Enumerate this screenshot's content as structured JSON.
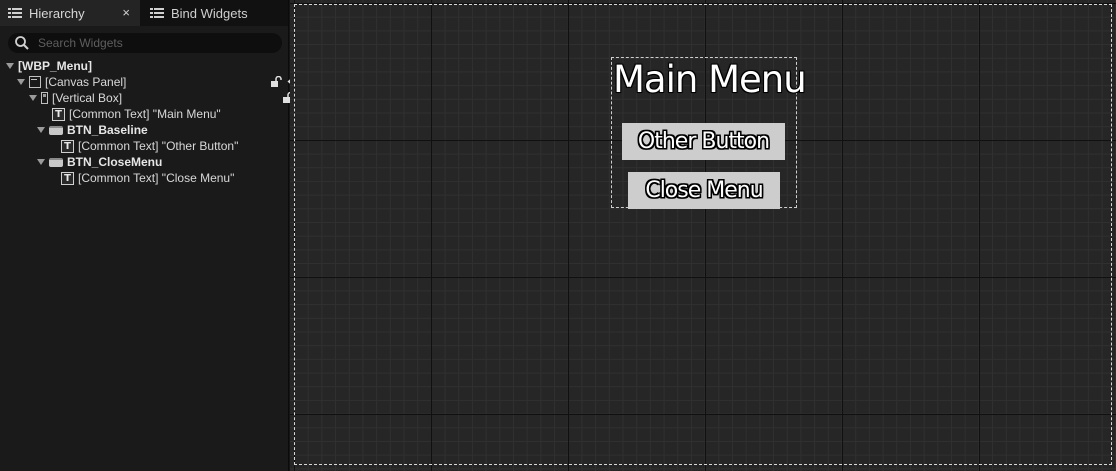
{
  "tabs": {
    "hierarchy": "Hierarchy",
    "close_glyph": "×",
    "bind_widgets": "Bind Widgets"
  },
  "search": {
    "placeholder": "Search Widgets",
    "value": ""
  },
  "tree": [
    {
      "label": "[WBP_Menu]",
      "icon": "none",
      "expanded": true
    },
    {
      "label": "[Canvas Panel]",
      "icon": "canvas-panel-icon",
      "expanded": true
    },
    {
      "label": "[Vertical Box]",
      "icon": "vertical-box-icon",
      "expanded": true
    },
    {
      "label": "[Common Text] \"Main Menu\"",
      "icon": "text-icon"
    },
    {
      "label": "BTN_Baseline",
      "icon": "button-icon",
      "expanded": true
    },
    {
      "label": "[Common Text] \"Other Button\"",
      "icon": "text-icon"
    },
    {
      "label": "BTN_CloseMenu",
      "icon": "button-icon",
      "expanded": true
    },
    {
      "label": "[Common Text] \"Close Menu\"",
      "icon": "text-icon"
    }
  ],
  "text_icon_glyph": "T",
  "designer": {
    "title": "Main Menu",
    "buttons": [
      "Other Button",
      "Close Menu"
    ],
    "button_color": "#cdcdcd",
    "background_color": "#262626"
  }
}
